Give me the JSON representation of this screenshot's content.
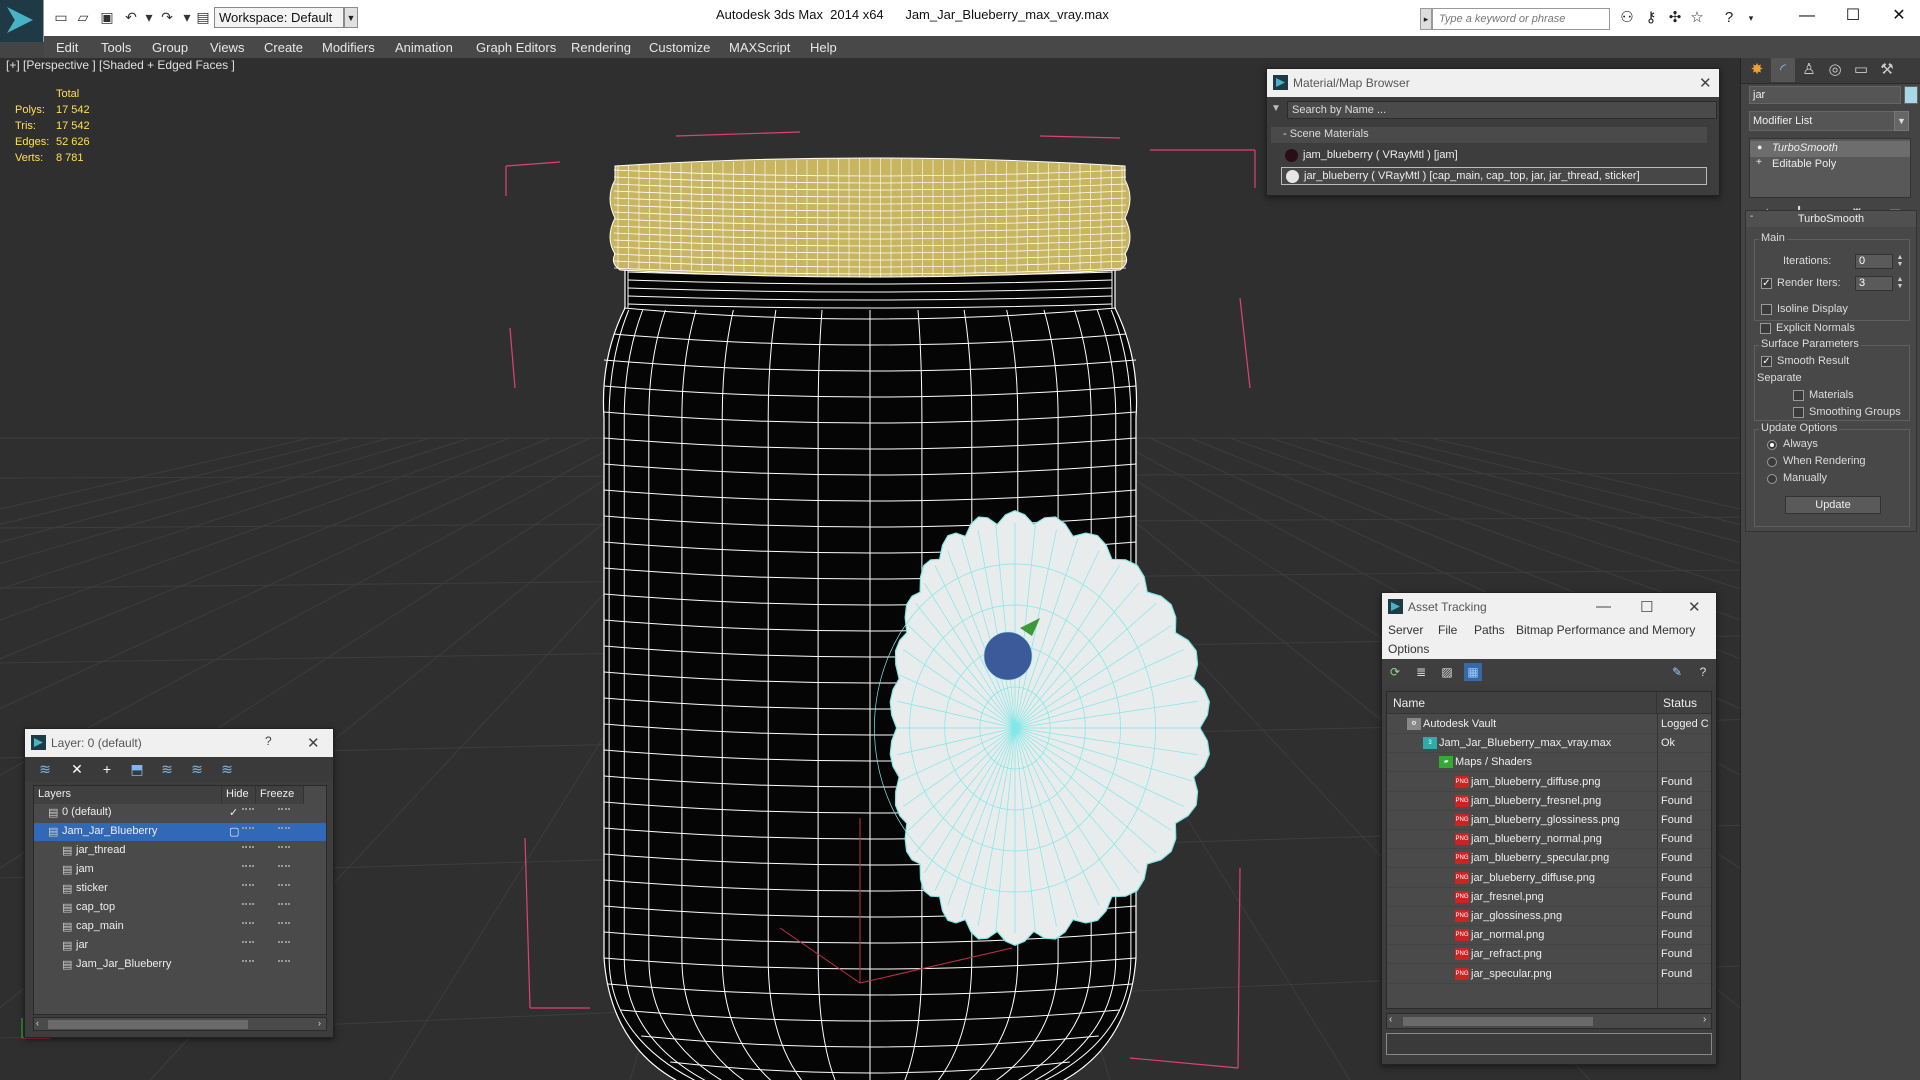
{
  "window": {
    "title": "Autodesk 3ds Max  2014 x64      Jam_Jar_Blueberry_max_vray.max",
    "workspace": "Workspace: Default",
    "search_placeholder": "Type a keyword or phrase",
    "help_label": "?"
  },
  "menu": [
    "Edit",
    "Tools",
    "Group",
    "Views",
    "Create",
    "Modifiers",
    "Animation",
    "Graph Editors",
    "Rendering",
    "Customize",
    "MAXScript",
    "Help"
  ],
  "viewport": {
    "label": "[+] [Perspective ] [Shaded + Edged Faces ]",
    "stats": {
      "header": "Total",
      "rows": [
        {
          "label": "Polys:",
          "value": "17 542"
        },
        {
          "label": "Tris:",
          "value": "17 542"
        },
        {
          "label": "Edges:",
          "value": "52 626"
        },
        {
          "label": "Verts:",
          "value": "8 781"
        }
      ]
    },
    "colors": {
      "cap": "#c8b560",
      "jar": "#050505",
      "wire": "#ffffff",
      "sticker": "#e8ecec",
      "sticker_wire": "#7fe8e8",
      "bbox": "#e0407a"
    }
  },
  "command_panel": {
    "object_name": "jar",
    "modifier_list": "Modifier List",
    "stack": [
      "TurboSmooth",
      "Editable Poly"
    ],
    "rollout_title": "TurboSmooth",
    "main": {
      "group": "Main",
      "iterations_label": "Iterations:",
      "iterations_value": "0",
      "render_iters_label": "Render Iters:",
      "render_iters_value": "3",
      "isoline": "Isoline Display",
      "explicit": "Explicit Normals"
    },
    "surface": {
      "group": "Surface Parameters",
      "smooth": "Smooth Result",
      "separate": "Separate",
      "materials": "Materials",
      "smoothing": "Smoothing Groups"
    },
    "update": {
      "group": "Update Options",
      "always": "Always",
      "when_rendering": "When Rendering",
      "manually": "Manually",
      "button": "Update"
    }
  },
  "material_browser": {
    "title": "Material/Map Browser",
    "search_placeholder": "Search by Name ...",
    "section": "- Scene Materials",
    "items": [
      {
        "label": "jam_blueberry  ( VRayMtl ) [jam]",
        "swatch": "#2a0d16"
      },
      {
        "label": "jar_blueberry  ( VRayMtl ) [cap_main, cap_top, jar, jar_thread, sticker]",
        "swatch": "#e6e6e6"
      }
    ]
  },
  "layer_panel": {
    "title": "Layer: 0 (default)",
    "help": "?",
    "columns": {
      "layers": "Layers",
      "hide": "Hide",
      "freeze": "Freeze"
    },
    "rows": [
      {
        "name": "0 (default)",
        "indent": 0
      },
      {
        "name": "Jam_Jar_Blueberry",
        "indent": 0
      },
      {
        "name": "jar_thread",
        "indent": 1
      },
      {
        "name": "jam",
        "indent": 1
      },
      {
        "name": "sticker",
        "indent": 1
      },
      {
        "name": "cap_top",
        "indent": 1
      },
      {
        "name": "cap_main",
        "indent": 1
      },
      {
        "name": "jar",
        "indent": 1
      },
      {
        "name": "Jam_Jar_Blueberry",
        "indent": 1
      }
    ]
  },
  "asset_tracking": {
    "title": "Asset Tracking",
    "menu": [
      "Server",
      "File",
      "Paths",
      "Bitmap Performance and Memory",
      "Options"
    ],
    "columns": {
      "name": "Name",
      "status": "Status"
    },
    "rows": [
      {
        "name": "Autodesk Vault",
        "status": "Logged C",
        "indent": 0,
        "icon": "vault"
      },
      {
        "name": "Jam_Jar_Blueberry_max_vray.max",
        "status": "Ok",
        "indent": 1,
        "icon": "max"
      },
      {
        "name": "Maps / Shaders",
        "status": "",
        "indent": 2,
        "icon": "folder"
      },
      {
        "name": "jam_blueberry_diffuse.png",
        "status": "Found",
        "indent": 3,
        "icon": "png"
      },
      {
        "name": "jam_blueberry_fresnel.png",
        "status": "Found",
        "indent": 3,
        "icon": "png"
      },
      {
        "name": "jam_blueberry_glossiness.png",
        "status": "Found",
        "indent": 3,
        "icon": "png"
      },
      {
        "name": "jam_blueberry_normal.png",
        "status": "Found",
        "indent": 3,
        "icon": "png"
      },
      {
        "name": "jam_blueberry_specular.png",
        "status": "Found",
        "indent": 3,
        "icon": "png"
      },
      {
        "name": "jar_blueberry_diffuse.png",
        "status": "Found",
        "indent": 3,
        "icon": "png"
      },
      {
        "name": "jar_fresnel.png",
        "status": "Found",
        "indent": 3,
        "icon": "png"
      },
      {
        "name": "jar_glossiness.png",
        "status": "Found",
        "indent": 3,
        "icon": "png"
      },
      {
        "name": "jar_normal.png",
        "status": "Found",
        "indent": 3,
        "icon": "png"
      },
      {
        "name": "jar_refract.png",
        "status": "Found",
        "indent": 3,
        "icon": "png"
      },
      {
        "name": "jar_specular.png",
        "status": "Found",
        "indent": 3,
        "icon": "png"
      }
    ]
  }
}
